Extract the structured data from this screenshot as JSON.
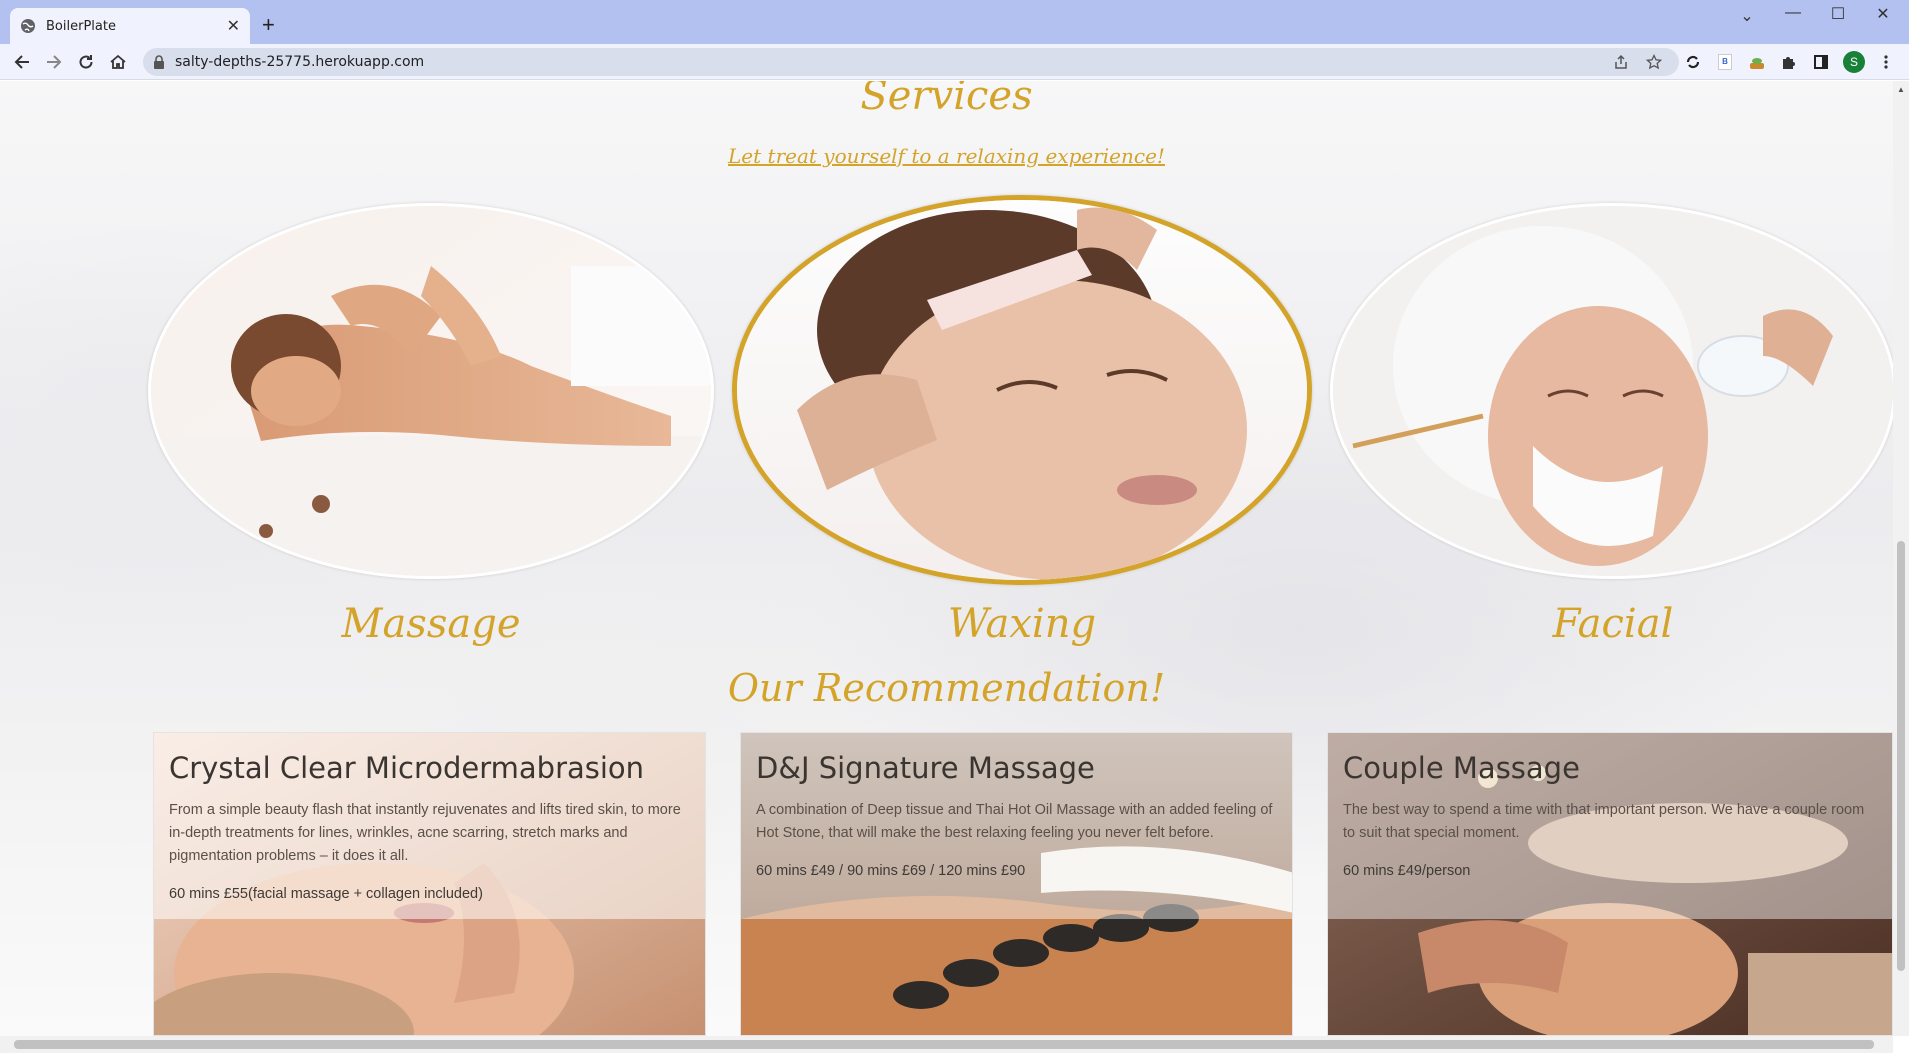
{
  "browser": {
    "tab_title": "BoilerPlate",
    "new_tab": "+",
    "url": "salty-depths-25775.herokuapp.com",
    "profile_initial": "S",
    "ext_b_label": "B",
    "close_tab": "✕",
    "win_minimize": "—",
    "win_maximize": "☐",
    "win_close": "✕",
    "tab_search": "⌄"
  },
  "services": {
    "title": "Services",
    "subtitle": "Let treat yourself to a relaxing experience!",
    "items": [
      {
        "label": "Massage"
      },
      {
        "label": "Waxing"
      },
      {
        "label": "Facial"
      }
    ]
  },
  "recommendation": {
    "title": "Our Recommendation!",
    "cards": [
      {
        "title": "Crystal Clear Microdermabrasion",
        "description": "From a simple beauty flash that instantly rejuvenates and lifts tired skin, to more in-depth treatments for lines, wrinkles, acne scarring, stretch marks and pigmentation problems – it does it all.",
        "price": "60 mins £55(facial massage + collagen included)"
      },
      {
        "title": "D&J Signature Massage",
        "description": "A combination of Deep tissue and Thai Hot Oil Massage with an added feeling of Hot Stone, that will make the best relaxing feeling you never felt before.",
        "price": "60 mins £49 / 90 mins £69 / 120 mins £90"
      },
      {
        "title": "Couple Massage",
        "description": "The best way to spend a time with that important person. We have a couple room to suit that special moment.",
        "price": "60 mins £49/person"
      }
    ]
  },
  "colors": {
    "accent_gold": "#d4a42a",
    "chrome_title": "#b3c1f0",
    "chrome_toolbar": "#f0f3fd",
    "profile_green": "#188038"
  }
}
